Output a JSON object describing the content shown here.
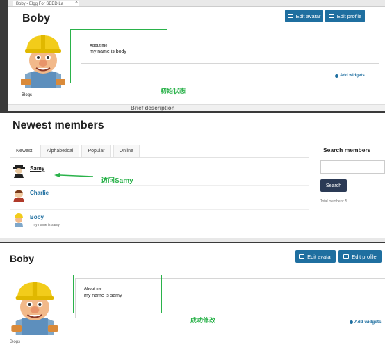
{
  "panel1": {
    "browser_tab": "Boby - Elgg For SEED La",
    "browser_tab_close": "×",
    "name": "Boby",
    "edit_avatar": "Edit avatar",
    "edit_profile": "Edit profile",
    "about_label": "About me",
    "about_text": "my name is body",
    "annotation": "初始状态",
    "add_widgets": "Add widgets",
    "blogs": "Blogs",
    "brief": "Brief description"
  },
  "panel2": {
    "title": "Newest members",
    "tabs": [
      {
        "label": "Newest"
      },
      {
        "label": "Alphabetical"
      },
      {
        "label": "Popular"
      },
      {
        "label": "Online"
      }
    ],
    "members": [
      {
        "name": "Samy",
        "desc": ""
      },
      {
        "name": "Charlie",
        "desc": ""
      },
      {
        "name": "Boby",
        "desc": "my name is samy"
      }
    ],
    "annotation": "访问Samy",
    "search_title": "Search members",
    "search_button": "Search",
    "total_members": "Total members: 5"
  },
  "panel3": {
    "name": "Boby",
    "edit_avatar": "Edit avatar",
    "edit_profile": "Edit profile",
    "about_label": "About me",
    "about_text": "my name is samy",
    "annotation": "成功修改",
    "add_widgets": "Add widgets",
    "blogs": "Blogs"
  },
  "colors": {
    "accent": "#1f6fa0",
    "annotation_green": "#2ab24a",
    "search_button": "#2b3a55"
  },
  "icons": {
    "avatar": "bob-the-builder-avatar",
    "edit_avatar": "image-icon",
    "edit_profile": "id-card-icon",
    "add_widgets": "gear-icon"
  }
}
